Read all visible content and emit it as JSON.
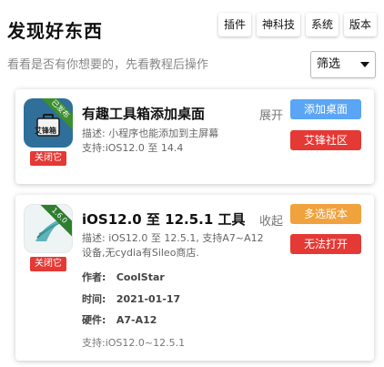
{
  "header": {
    "title": "发现好东西",
    "tags": [
      "插件",
      "神科技",
      "系统",
      "版本"
    ]
  },
  "subtitle": "看看是否有你想要的，先看教程后操作",
  "filter": {
    "selected": "筛选"
  },
  "cards": [
    {
      "icon_label": "艾锋箱",
      "ribbon": "已发布",
      "close_badge": "关闭它",
      "title": "有趣工具箱添加桌面",
      "desc": "描述: 小程序也能添加到主屏幕",
      "support": "支持:iOS12.0 至 14.4",
      "toggle": "展开",
      "primary_button": "添加桌面",
      "secondary_button": "艾锋社区",
      "colors": {
        "primary": "#5aa5f5",
        "secondary": "#e53935"
      }
    },
    {
      "ribbon": "1.6.0",
      "close_badge": "关闭它",
      "title": "iOS12.0 至 12.5.1 工具",
      "desc": "描述: iOS12.0 至 12.5.1, 支持A7~A12",
      "desc_line2": "设备,无cydia有Sileo商店.",
      "toggle": "收起",
      "primary_button": "多选版本",
      "secondary_button": "无法打开",
      "meta": [
        {
          "key": "作者:",
          "value": "CoolStar"
        },
        {
          "key": "时间:",
          "value": "2021-01-17"
        },
        {
          "key": "硬件:",
          "value": "A7-A12"
        }
      ],
      "support": "支持:iOS12.0~12.5.1",
      "colors": {
        "primary": "#f0a23c",
        "secondary": "#e53935"
      }
    }
  ]
}
